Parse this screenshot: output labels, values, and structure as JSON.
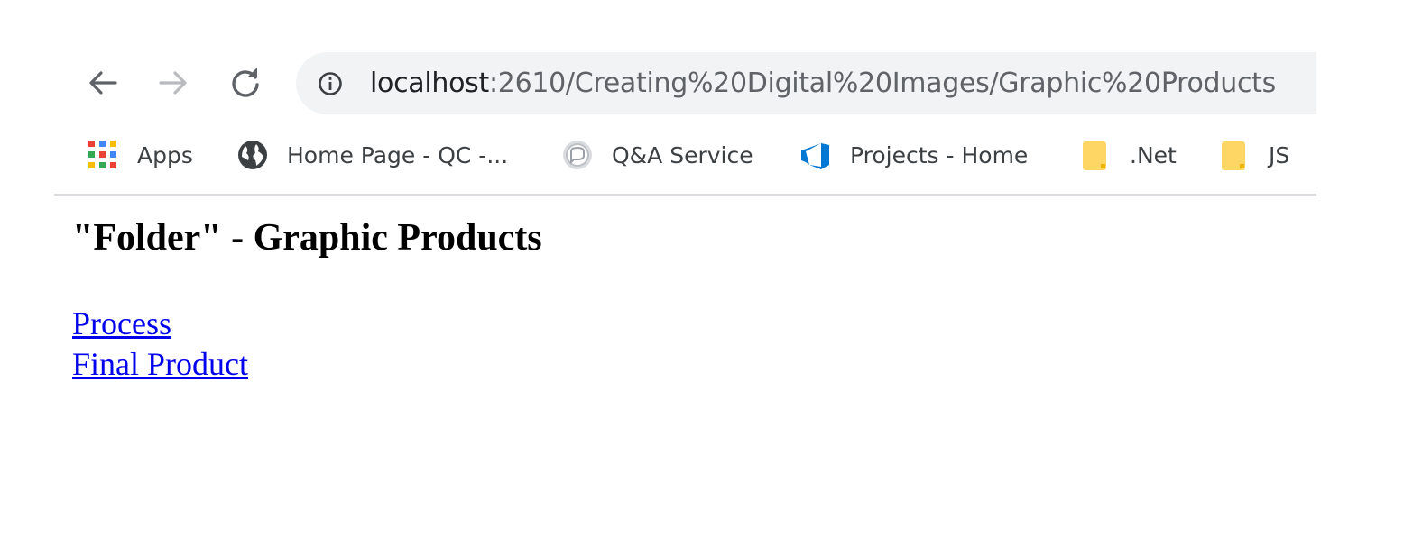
{
  "browser": {
    "address_bar": {
      "host": "localhost",
      "path": ":2610/Creating%20Digital%20Images/Graphic%20Products"
    },
    "nav": {
      "back_icon": "arrow-left",
      "forward_icon": "arrow-right",
      "reload_icon": "reload",
      "site_info_icon": "info-circle"
    },
    "bookmarks": [
      {
        "label": "Apps",
        "icon": "apps-grid"
      },
      {
        "label": "Home Page - QC -...",
        "icon": "globe"
      },
      {
        "label": "Q&A Service",
        "icon": "chat-circle"
      },
      {
        "label": "Projects - Home",
        "icon": "azure-devops"
      },
      {
        "label": ".Net",
        "icon": "folder"
      },
      {
        "label": "JS",
        "icon": "folder"
      }
    ]
  },
  "page": {
    "title": "\"Folder\" - Graphic Products",
    "links": [
      {
        "label": "Process"
      },
      {
        "label": "Final Product"
      }
    ]
  },
  "colors": {
    "link": "#0000ee",
    "omnibox_bg": "#f1f3f4",
    "folder": "#fdd663",
    "azure": "#0078d4"
  }
}
